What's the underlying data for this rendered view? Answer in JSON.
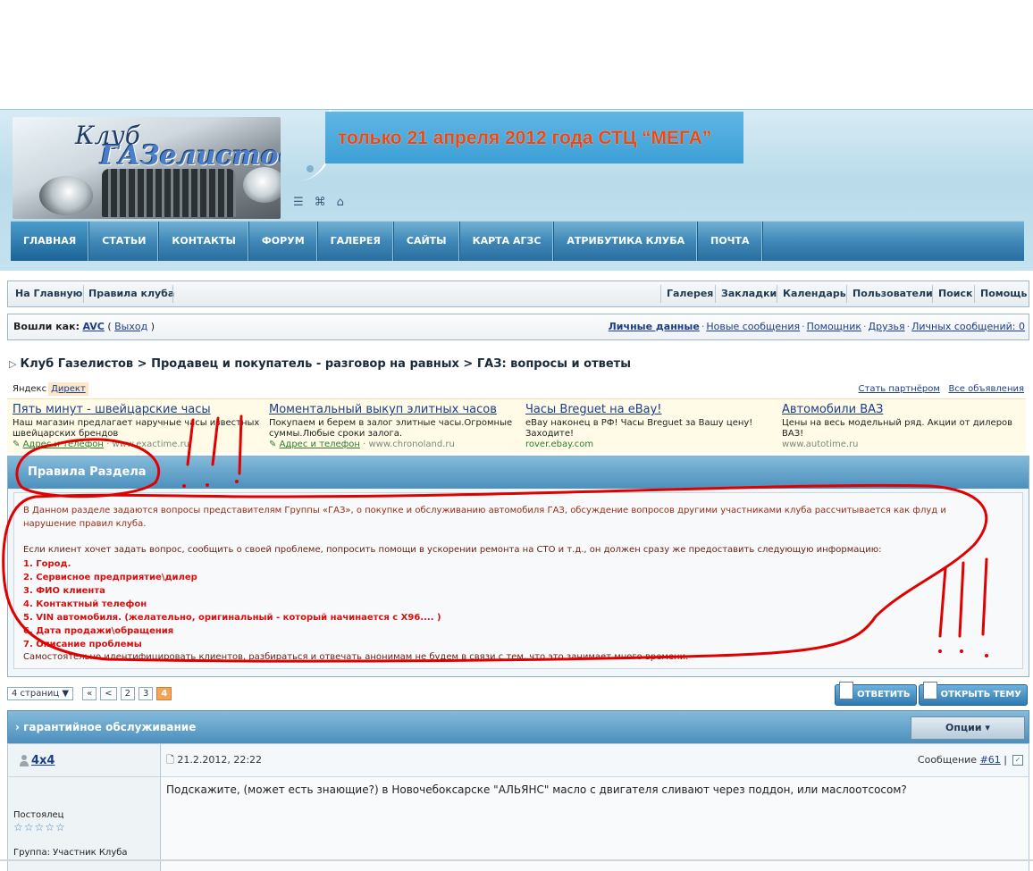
{
  "banner": {
    "text": "только 21 апреля 2012 года СТЦ “МЕГА”"
  },
  "logo": {
    "line1": "Клуб",
    "line2": "ГАЗелистов"
  },
  "nav": [
    "ГЛАВНАЯ",
    "СТАТЬИ",
    "КОНТАКТЫ",
    "ФОРУМ",
    "ГАЛЕРЕЯ",
    "САЙТЫ",
    "КАРТА АГЗС",
    "АТРИБУТИКА КЛУБА",
    "ПОЧТА"
  ],
  "topbar": {
    "left": [
      "На Главную",
      "Правила клуба"
    ],
    "right": [
      "Галерея",
      "Закладки",
      "Календарь",
      "Пользователи",
      "Поиск",
      "Помощь"
    ]
  },
  "userbar": {
    "logged_as": "Вошли как:",
    "user": "AVC",
    "logout": "Выход",
    "links": [
      "Личные данные",
      "Новые сообщения",
      "Помощник",
      "Друзья",
      "Личных сообщений: 0"
    ]
  },
  "breadcrumb": [
    "Клуб Газелистов",
    "Продавец и покупатель - разговор на равных",
    "ГАЗ: вопросы и ответы"
  ],
  "yandex": {
    "label": "Яндекс",
    "direct": "Директ",
    "partner": "Стать партнёром",
    "all_ads": "Все объявления"
  },
  "ads": [
    {
      "title": "Пять минут - швейцарские часы",
      "desc": "Наш магазин предлагает наручные часы известных швейцарских брендов",
      "addr": "Адрес и телефон",
      "url": "www.exactime.ru"
    },
    {
      "title": "Моментальный выкуп элитных часов",
      "desc": "Покупаем и берем в залог элитные часы.Огромные суммы.Любые сроки залога.",
      "addr": "Адрес и телефон",
      "url": "www.chronoland.ru"
    },
    {
      "title": "Часы Breguet на eBay!",
      "desc": "eBay наконец в РФ! Часы Breguet за Вашу цену! Заходите!",
      "addr": "",
      "url": "rover.ebay.com"
    },
    {
      "title": "Автомобили ВАЗ",
      "desc": "Цены на весь модельный ряд. Акции от дилеров ВАЗ!",
      "addr": "",
      "url": "www.autotime.ru"
    }
  ],
  "rules": {
    "title": "Правила Раздела",
    "intro": "В Данном разделе задаются вопросы представителям Группы «ГАЗ», о покупке и обслуживанию автомобиля ГАЗ, обсуждение вопросов другими участниками клуба рассчитывается как флуд и нарушение правил клуба.",
    "client": "Если клиент хочет задать вопрос, сообщить о своей проблеме, попросить помощи в ускорении ремонта на СТО и т.д., он должен сразу же предоставить следующую информацию:",
    "items": [
      "1. Город.",
      "2. Сервисное предприятие\\дилер",
      "3. ФИО клиента",
      "4. Контактный телефон",
      "5. VIN автомобиля. (желательно, оригинальный - который начинается с X96.... )",
      "6. Дата продажи\\обращения",
      "7. Описание проблемы"
    ],
    "footer": "Самостоятельно идентифицировать клиентов, разбираться и отвечать анонимам не будем в связи с тем, что это занимает много времени."
  },
  "pager": {
    "label": "4 страниц",
    "first": "«",
    "prev": "<",
    "pages": [
      "2",
      "3",
      "4"
    ],
    "current": "4"
  },
  "buttons": {
    "reply": "ОТВЕТИТЬ",
    "new_topic": "ОТКРЫТЬ ТЕМУ"
  },
  "thread": {
    "title": "гарантийное обслуживание",
    "options": "Опции"
  },
  "post": {
    "author": "4x4",
    "date": "21.2.2012, 22:22",
    "number_label": "Сообщение",
    "number": "#61",
    "rank": "Постоялец",
    "stars": "☆☆☆☆☆",
    "group": "Группа: Участник Клуба",
    "text": "Подскажите, (может есть знающие?) в Новочебоксарске \"АЛЬЯНС\" масло с двигателя сливают через поддон, или маслоотсосом?"
  },
  "colors": {
    "accent": "#3f88b7",
    "annotation": "#e00000",
    "banner_text": "#e84a16"
  }
}
